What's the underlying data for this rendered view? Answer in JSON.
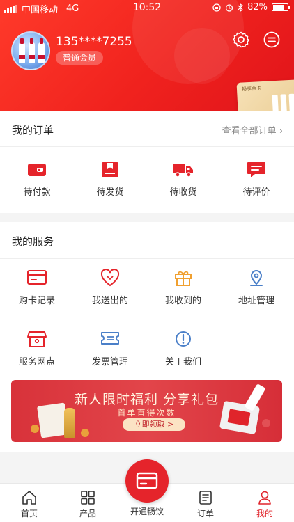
{
  "status_bar": {
    "carrier": "中国移动",
    "network": "4G",
    "time": "10:52",
    "battery": "82%",
    "battery_level": 0.82
  },
  "profile": {
    "phone": "135****7255",
    "member_level": "普通会员",
    "card_text": "畅享金卡"
  },
  "orders": {
    "title": "我的订单",
    "view_all": "查看全部订单",
    "items": [
      {
        "label": "待付款",
        "icon": "wallet-icon"
      },
      {
        "label": "待发货",
        "icon": "package-icon"
      },
      {
        "label": "待收货",
        "icon": "truck-icon"
      },
      {
        "label": "待评价",
        "icon": "comment-icon"
      }
    ]
  },
  "services": {
    "title": "我的服务",
    "items": [
      {
        "label": "购卡记录",
        "icon": "card-icon"
      },
      {
        "label": "我送出的",
        "icon": "heart-icon"
      },
      {
        "label": "我收到的",
        "icon": "gift-icon"
      },
      {
        "label": "地址管理",
        "icon": "location-icon"
      },
      {
        "label": "服务网点",
        "icon": "store-icon"
      },
      {
        "label": "发票管理",
        "icon": "invoice-icon"
      },
      {
        "label": "关于我们",
        "icon": "info-icon"
      }
    ]
  },
  "banner": {
    "title": "新人限时福利  分享礼包",
    "subtitle": "首单直得次数",
    "cta": "立即领取 >"
  },
  "tabbar": {
    "items": [
      {
        "label": "首页",
        "icon": "home-icon"
      },
      {
        "label": "产品",
        "icon": "grid-icon"
      },
      {
        "label": "开通畅饮",
        "icon": "card-icon"
      },
      {
        "label": "订单",
        "icon": "order-icon"
      },
      {
        "label": "我的",
        "icon": "user-icon",
        "active": true
      }
    ]
  },
  "colors": {
    "brand_red": "#e5242b",
    "orange": "#f0a030",
    "blue": "#4a7fc8"
  }
}
